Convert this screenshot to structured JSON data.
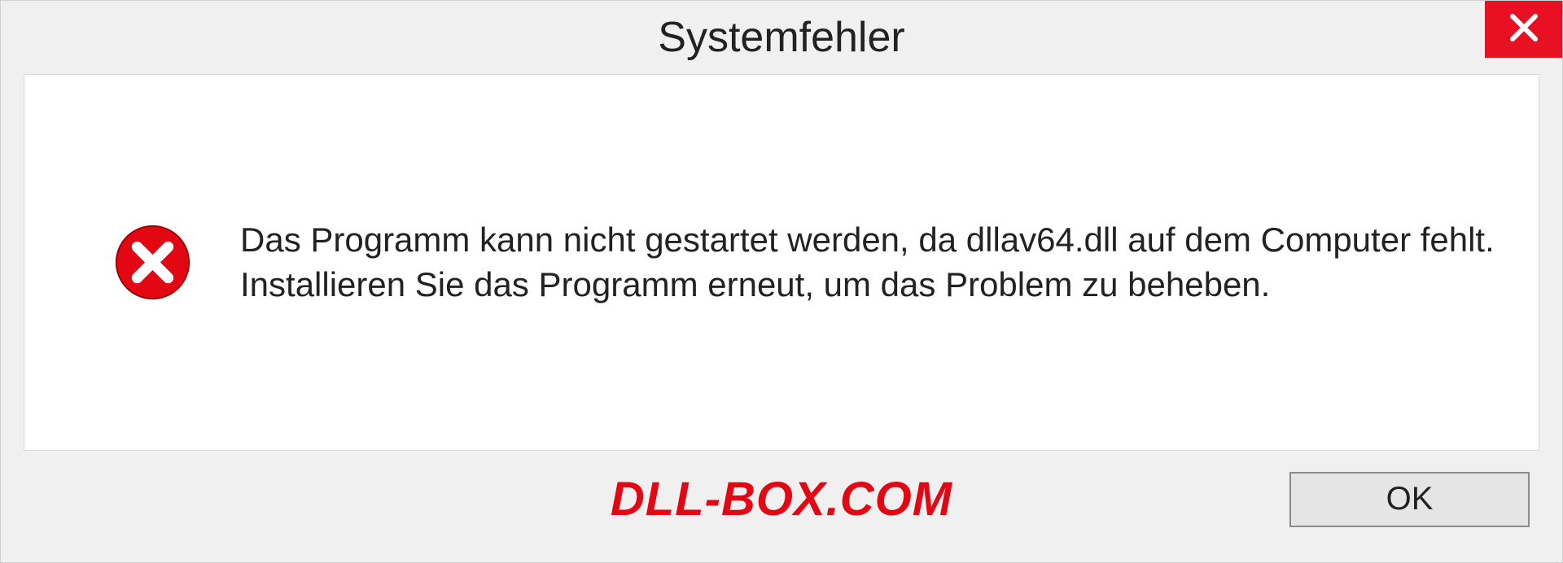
{
  "dialog": {
    "title": "Systemfehler",
    "message": "Das Programm kann nicht gestartet werden, da dllav64.dll auf dem Computer fehlt. Installieren Sie das Programm erneut, um das Problem zu beheben.",
    "ok_label": "OK"
  },
  "watermark": "DLL-BOX.COM"
}
